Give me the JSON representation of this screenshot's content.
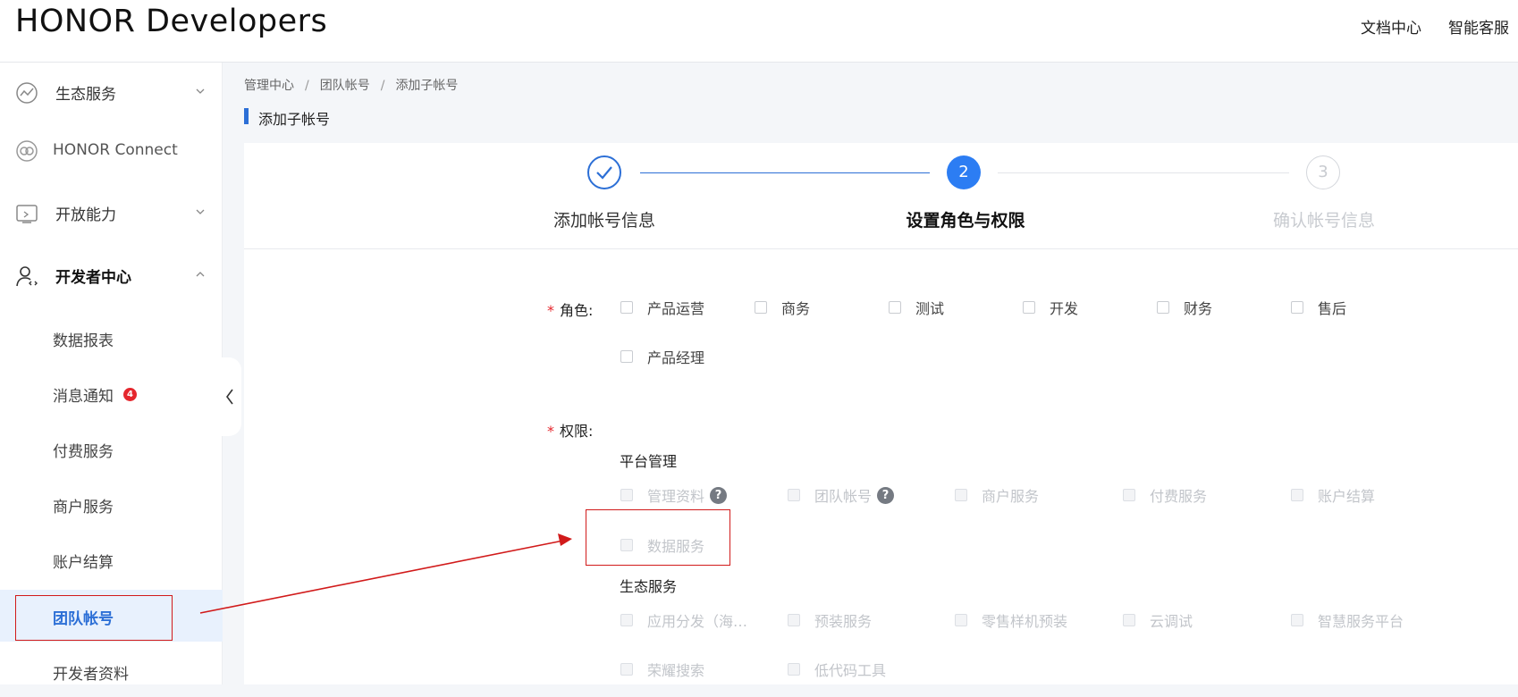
{
  "header": {
    "logo": "HONOR Developers",
    "links": [
      "文档中心",
      "智能客服"
    ]
  },
  "sidebar": {
    "items": [
      {
        "label": "生态服务",
        "icon": "ecosystem-icon",
        "expandable": true,
        "expanded": false
      },
      {
        "label": "HONOR Connect",
        "icon": "connect-icon",
        "expandable": false
      },
      {
        "label": "开放能力",
        "icon": "open-capability-icon",
        "expandable": true,
        "expanded": false
      },
      {
        "label": "开发者中心",
        "icon": "developer-icon",
        "expandable": true,
        "expanded": true
      }
    ],
    "sub_items": [
      {
        "label": "数据报表"
      },
      {
        "label": "消息通知",
        "badge": "4"
      },
      {
        "label": "付费服务"
      },
      {
        "label": "商户服务"
      },
      {
        "label": "账户结算"
      },
      {
        "label": "团队帐号",
        "active": true
      },
      {
        "label": "开发者资料"
      }
    ]
  },
  "breadcrumb": [
    "管理中心",
    "团队帐号",
    "添加子帐号"
  ],
  "page_title": "添加子帐号",
  "steps": [
    {
      "label": "添加帐号信息",
      "status": "done"
    },
    {
      "label": "设置角色与权限",
      "number": "2",
      "status": "current"
    },
    {
      "label": "确认帐号信息",
      "number": "3",
      "status": "pending"
    }
  ],
  "form": {
    "role_label": "角色:",
    "roles": [
      "产品运营",
      "商务",
      "测试",
      "开发",
      "财务",
      "售后",
      "产品经理"
    ],
    "permission_label": "权限:",
    "groups": [
      {
        "title": "平台管理",
        "items": [
          {
            "label": "管理资料",
            "help": "?"
          },
          {
            "label": "团队帐号",
            "help": "?"
          },
          {
            "label": "商户服务"
          },
          {
            "label": "付费服务"
          },
          {
            "label": "账户结算"
          },
          {
            "label": "数据服务"
          }
        ]
      },
      {
        "title": "生态服务",
        "items": [
          {
            "label": "应用分发（海…"
          },
          {
            "label": "预装服务"
          },
          {
            "label": "零售样机预装"
          },
          {
            "label": "云调试"
          },
          {
            "label": "智慧服务平台"
          },
          {
            "label": "荣耀搜索"
          },
          {
            "label": "低代码工具"
          }
        ]
      }
    ]
  },
  "colors": {
    "accent": "#2c6fd6",
    "annotation": "#d11a1a",
    "badge": "#e5262d"
  }
}
